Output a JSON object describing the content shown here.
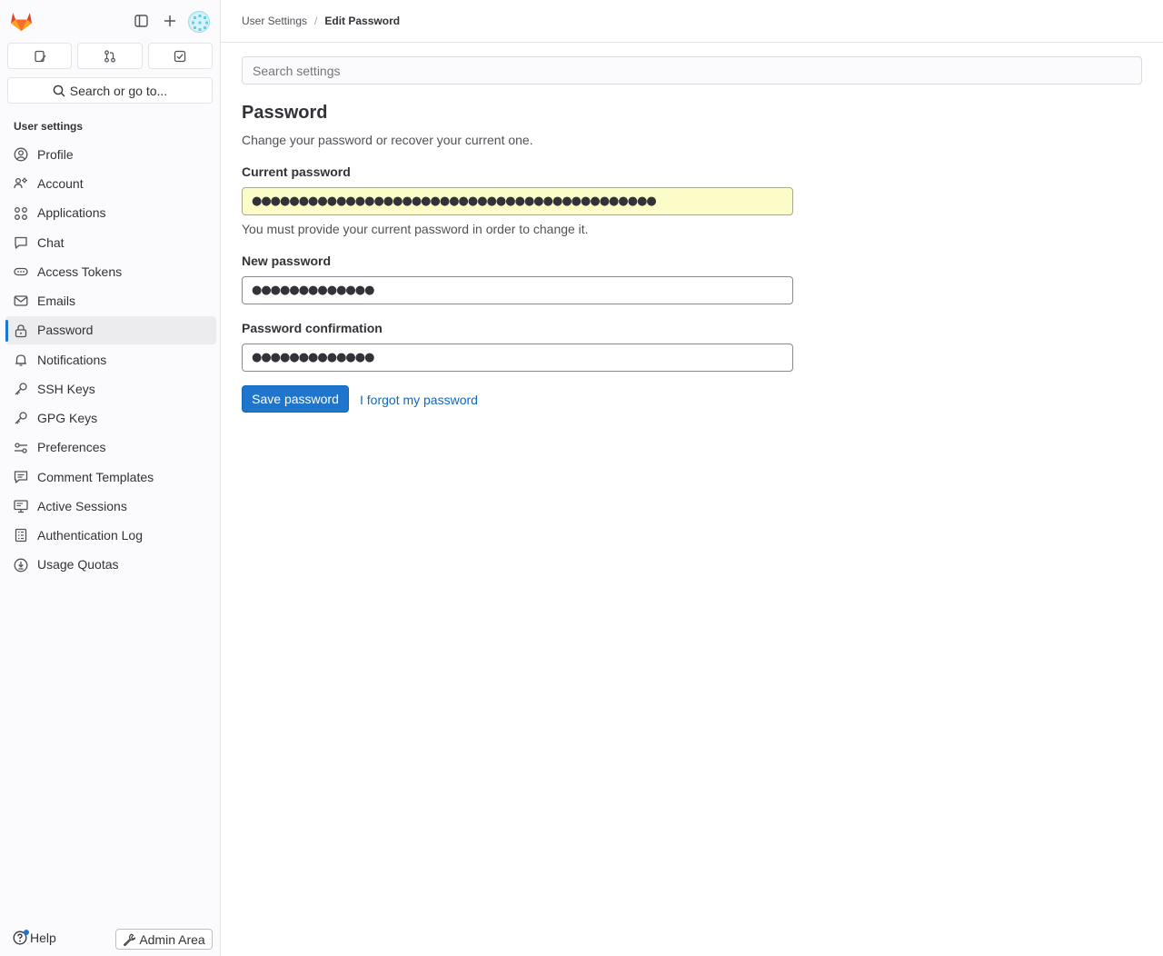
{
  "sidebar": {
    "section_title": "User settings",
    "search_label": "Search or go to...",
    "items": [
      {
        "label": "Profile",
        "icon": "profile-icon"
      },
      {
        "label": "Account",
        "icon": "account-icon"
      },
      {
        "label": "Applications",
        "icon": "applications-icon"
      },
      {
        "label": "Chat",
        "icon": "chat-icon"
      },
      {
        "label": "Access Tokens",
        "icon": "token-icon"
      },
      {
        "label": "Emails",
        "icon": "mail-icon"
      },
      {
        "label": "Password",
        "icon": "lock-icon",
        "active": true
      },
      {
        "label": "Notifications",
        "icon": "bell-icon"
      },
      {
        "label": "SSH Keys",
        "icon": "key-icon"
      },
      {
        "label": "GPG Keys",
        "icon": "key-icon"
      },
      {
        "label": "Preferences",
        "icon": "preferences-icon"
      },
      {
        "label": "Comment Templates",
        "icon": "comment-icon"
      },
      {
        "label": "Active Sessions",
        "icon": "monitor-icon"
      },
      {
        "label": "Authentication Log",
        "icon": "log-icon"
      },
      {
        "label": "Usage Quotas",
        "icon": "quota-icon"
      }
    ],
    "help_label": "Help",
    "admin_label": "Admin Area"
  },
  "breadcrumb": {
    "parent": "User Settings",
    "separator": "/",
    "current": "Edit Password"
  },
  "search": {
    "placeholder": "Search settings"
  },
  "page": {
    "title": "Password",
    "subtitle": "Change your password or recover your current one."
  },
  "form": {
    "current_label": "Current password",
    "current_value": "●●●●●●●●●●●●●●●●●●●●●●●●●●●●●●●●●●●●●●●●●●●",
    "current_help": "You must provide your current password in order to change it.",
    "new_label": "New password",
    "new_value": "●●●●●●●●●●●●●",
    "confirm_label": "Password confirmation",
    "confirm_value": "●●●●●●●●●●●●●",
    "save_label": "Save password",
    "forgot_label": "I forgot my password"
  },
  "colors": {
    "accent": "#1f75cb",
    "link": "#1068bf",
    "autofill": "#fcfcc8"
  }
}
